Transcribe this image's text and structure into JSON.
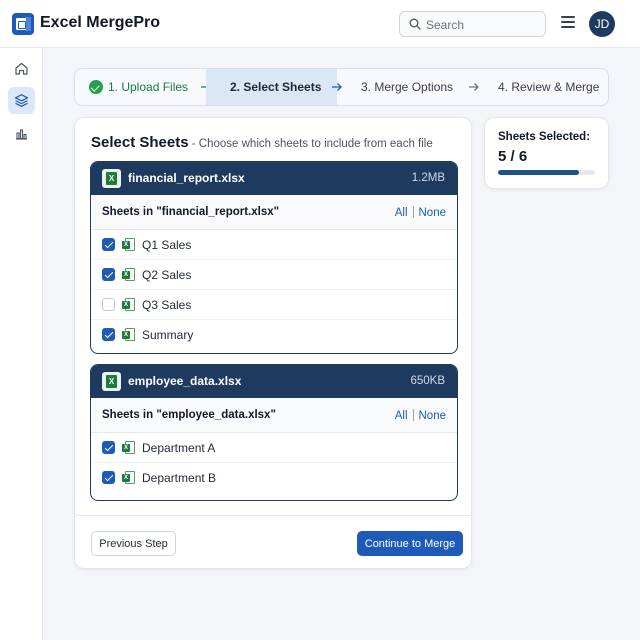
{
  "app": {
    "title": "Excel MergePro",
    "brand_color": "#1e5bb8"
  },
  "search": {
    "placeholder": "Search"
  },
  "user": {
    "initials": "JD"
  },
  "sidebar": {
    "items": [
      {
        "icon": "home-icon",
        "active": false
      },
      {
        "icon": "layers-icon",
        "active": true
      },
      {
        "icon": "chart-icon",
        "active": false
      }
    ]
  },
  "steps": [
    {
      "label": "1. Upload Files",
      "status": "done"
    },
    {
      "label": "2. Select Sheets",
      "status": "active"
    },
    {
      "label": "3. Merge Options",
      "status": "pending"
    },
    {
      "label": "4. Review & Merge",
      "status": "pending"
    }
  ],
  "main": {
    "title": "Select Sheets",
    "subtitle": " - Choose which sheets to include from each file",
    "files": [
      {
        "name": "financial_report.xlsx",
        "size": "1.2MB",
        "sheets_label": "Sheets in \"financial_report.xlsx\"",
        "all_label": "All",
        "none_label": "None",
        "sheets": [
          {
            "name": "Q1 Sales",
            "checked": true
          },
          {
            "name": "Q2 Sales",
            "checked": true
          },
          {
            "name": "Q3 Sales",
            "checked": false
          },
          {
            "name": "Summary",
            "checked": true
          }
        ]
      },
      {
        "name": "employee_data.xlsx",
        "size": "650KB",
        "sheets_label": "Sheets in \"employee_data.xlsx\"",
        "all_label": "All",
        "none_label": "None",
        "sheets": [
          {
            "name": "Department A",
            "checked": true
          },
          {
            "name": "Department B",
            "checked": true
          }
        ]
      }
    ],
    "prev_label": "Previous Step",
    "next_label": "Continue to Merge"
  },
  "summary": {
    "label": "Sheets Selected:",
    "count": "5 / 6",
    "progress": 0.83
  },
  "colors": {
    "navy": "#1e3a5f",
    "success": "#22a04b",
    "step_active_bg": "#dbe7f6"
  }
}
